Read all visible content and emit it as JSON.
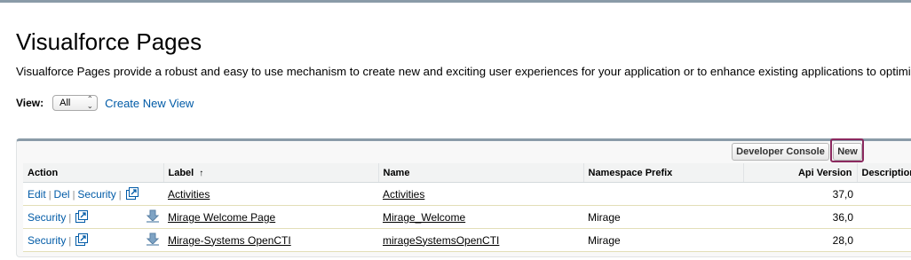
{
  "page": {
    "title": "Visualforce Pages",
    "description": "Visualforce Pages provide a robust and easy to use mechanism to create new and exciting user experiences for your application or to enhance existing applications to optimize"
  },
  "view": {
    "label": "View:",
    "selected": "All",
    "create_link": "Create New View"
  },
  "toolbar": {
    "developer_console": "Developer Console",
    "new": "New"
  },
  "table": {
    "headers": {
      "action": "Action",
      "label": "Label",
      "label_sort": "↑",
      "name": "Name",
      "namespace": "Namespace Prefix",
      "api_version": "Api Version",
      "description": "Description"
    },
    "rows": [
      {
        "actions": [
          "Edit",
          "Del",
          "Security"
        ],
        "label": "Activities",
        "name": "Activities",
        "namespace": "",
        "api_version": "37,0",
        "description": ""
      },
      {
        "actions": [
          "Security"
        ],
        "label": "Mirage Welcome Page",
        "name": "Mirage_Welcome",
        "namespace": "Mirage",
        "api_version": "36,0",
        "description": ""
      },
      {
        "actions": [
          "Security"
        ],
        "label": "Mirage-Systems OpenCTI",
        "name": "mirageSystemsOpenCTI",
        "namespace": "Mirage",
        "api_version": "28,0",
        "description": ""
      }
    ]
  },
  "icons": {
    "popup": "open-in-window-icon",
    "download": "managed-package-icon",
    "select": "chevron-updown-icon"
  },
  "colors": {
    "link": "#015ba7",
    "header_bar": "#8a9ba8",
    "highlight_ring": "#8b2a5f"
  }
}
